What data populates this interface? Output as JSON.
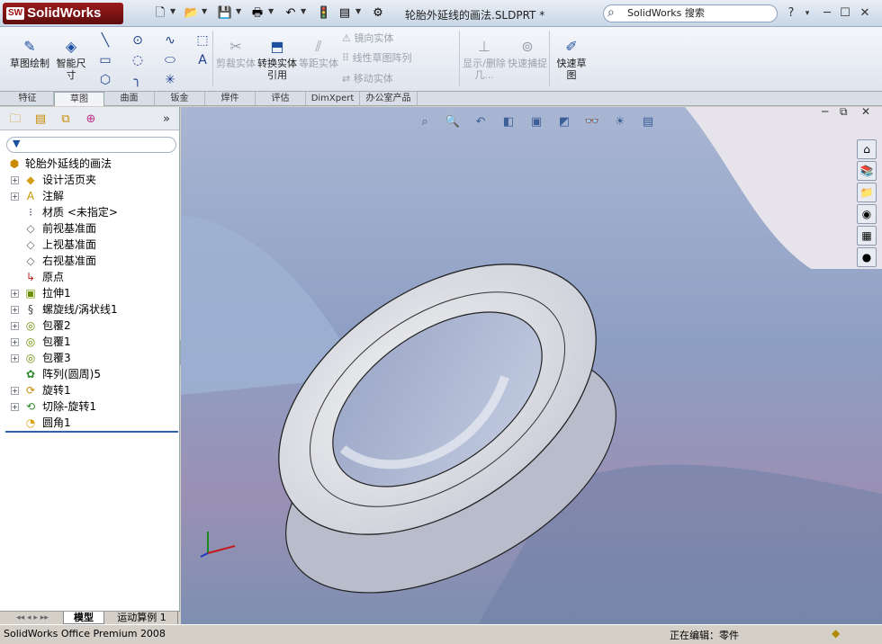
{
  "app": {
    "brand": "SolidWorks",
    "brand_badge": "SW",
    "doc_title": "轮胎外延线的画法.SLDPRT *",
    "search_placeholder": "SolidWorks 搜索"
  },
  "quick_access": [
    {
      "icon": "new-icon",
      "glyph": "🗋"
    },
    {
      "icon": "open-icon",
      "glyph": "📂"
    },
    {
      "icon": "save-icon",
      "glyph": "💾"
    },
    {
      "icon": "print-icon",
      "glyph": "🖶"
    },
    {
      "icon": "undo-icon",
      "glyph": "↶"
    },
    {
      "icon": "rebuild-icon",
      "glyph": "🚦"
    },
    {
      "icon": "file-props-icon",
      "glyph": "▤"
    },
    {
      "icon": "options-icon",
      "glyph": "⚙"
    }
  ],
  "window_buttons": [
    "?",
    "▾",
    "─",
    "☐",
    "✕"
  ],
  "ribbon": {
    "sketch": "草图绘制",
    "smart_dim": "智能尺寸",
    "trim": "剪裁实体",
    "convert": "转换实体引用",
    "offset": "等距实体",
    "mirror": "镜向实体",
    "linear_pattern": "线性草图阵列",
    "move": "移动实体",
    "show_hide": "显示/删除几...",
    "quick_snap": "快速捕捉",
    "rapid_sketch": "快速草图"
  },
  "cmd_tabs": [
    "特征",
    "草图",
    "曲面",
    "钣金",
    "焊件",
    "评估",
    "DimXpert",
    "办公室产品"
  ],
  "active_tab": "草图",
  "tree": {
    "root": "轮胎外延线的画法",
    "items": [
      {
        "label": "设计活页夹",
        "icon": "◆",
        "expand": true,
        "color": "#d4a017"
      },
      {
        "label": "注解",
        "icon": "A",
        "expand": true,
        "color": "#c99700"
      },
      {
        "label": "材质 <未指定>",
        "icon": "⁝",
        "expand": false,
        "color": "#335"
      },
      {
        "label": "前视基准面",
        "icon": "◇",
        "expand": false,
        "color": "#666"
      },
      {
        "label": "上视基准面",
        "icon": "◇",
        "expand": false,
        "color": "#666"
      },
      {
        "label": "右视基准面",
        "icon": "◇",
        "expand": false,
        "color": "#666"
      },
      {
        "label": "原点",
        "icon": "↳",
        "expand": false,
        "color": "#b22"
      },
      {
        "label": "拉伸1",
        "icon": "▣",
        "expand": true,
        "color": "#6a8f00"
      },
      {
        "label": "螺旋线/涡状线1",
        "icon": "§",
        "expand": true,
        "color": "#444"
      },
      {
        "label": "包覆2",
        "icon": "◎",
        "expand": true,
        "color": "#6a8f00"
      },
      {
        "label": "包覆1",
        "icon": "◎",
        "expand": true,
        "color": "#6a8f00"
      },
      {
        "label": "包覆3",
        "icon": "◎",
        "expand": true,
        "color": "#6a8f00"
      },
      {
        "label": "阵列(圆周)5",
        "icon": "✿",
        "expand": false,
        "color": "#2d8a2d"
      },
      {
        "label": "旋转1",
        "icon": "⟳",
        "expand": true,
        "color": "#c98a00"
      },
      {
        "label": "切除-旋转1",
        "icon": "⟲",
        "expand": true,
        "color": "#2d8a2d"
      },
      {
        "label": "圆角1",
        "icon": "◔",
        "expand": false,
        "color": "#d9a000"
      }
    ]
  },
  "bottom_tabs": {
    "model": "模型",
    "motion": "运动算例 1"
  },
  "status": {
    "left": "SolidWorks Office Premium 2008",
    "right": "正在编辑：零件"
  },
  "hud_icons": [
    "zoom-fit-icon",
    "zoom-area-icon",
    "previous-view-icon",
    "section-view-icon",
    "view-orientation-icon",
    "display-style-icon",
    "hide-show-icon",
    "scene-icon",
    "view-settings-icon"
  ],
  "task_pane": [
    "home-icon",
    "design-library-icon",
    "file-explorer-icon",
    "view-palette-icon",
    "appearances-icon",
    "custom-props-icon"
  ]
}
